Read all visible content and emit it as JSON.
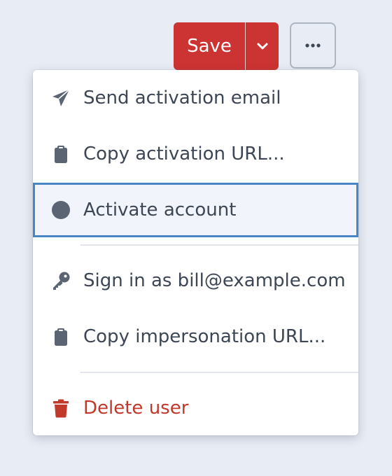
{
  "toolbar": {
    "save_label": "Save",
    "save_color": "#cc3333",
    "dropdown_icon": "chevron-down-icon",
    "more_icon": "ellipsis-icon"
  },
  "menu": {
    "items": [
      {
        "label": "Send activation email",
        "icon": "paper-plane-icon"
      },
      {
        "label": "Copy activation URL...",
        "icon": "clipboard-icon"
      },
      {
        "label": "Activate account",
        "icon": "circle-icon",
        "state": "focused"
      },
      {
        "label": "Sign in as bill@example.com",
        "icon": "key-icon"
      },
      {
        "label": "Copy impersonation URL...",
        "icon": "clipboard-icon"
      },
      {
        "label": "Delete user",
        "icon": "trash-icon",
        "tone": "danger"
      }
    ],
    "text_color": "#3d4654",
    "danger_color": "#c0392b",
    "focus_border_color": "#4a86c4"
  }
}
